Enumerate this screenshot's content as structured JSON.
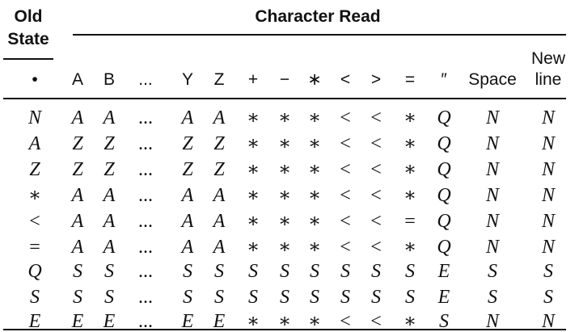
{
  "header": {
    "old_state_line1": "Old",
    "old_state_line2": "State",
    "group_title": "Character Read"
  },
  "columns": [
    "•",
    "A",
    "B",
    "...",
    "Y",
    "Z",
    "+",
    "−",
    "∗",
    "<",
    ">",
    "=",
    "″",
    "Space",
    "New line"
  ],
  "rows": [
    [
      "N",
      "A",
      "A",
      "...",
      "A",
      "A",
      "∗",
      "∗",
      "∗",
      "<",
      "<",
      "∗",
      "Q",
      "N",
      "N"
    ],
    [
      "A",
      "Z",
      "Z",
      "...",
      "Z",
      "Z",
      "∗",
      "∗",
      "∗",
      "<",
      "<",
      "∗",
      "Q",
      "N",
      "N"
    ],
    [
      "Z",
      "Z",
      "Z",
      "...",
      "Z",
      "Z",
      "∗",
      "∗",
      "∗",
      "<",
      "<",
      "∗",
      "Q",
      "N",
      "N"
    ],
    [
      "∗",
      "A",
      "A",
      "...",
      "A",
      "A",
      "∗",
      "∗",
      "∗",
      "<",
      "<",
      "∗",
      "Q",
      "N",
      "N"
    ],
    [
      "<",
      "A",
      "A",
      "...",
      "A",
      "A",
      "∗",
      "∗",
      "∗",
      "<",
      "<",
      "=",
      "Q",
      "N",
      "N"
    ],
    [
      "=",
      "A",
      "A",
      "...",
      "A",
      "A",
      "∗",
      "∗",
      "∗",
      "<",
      "<",
      "∗",
      "Q",
      "N",
      "N"
    ],
    [
      "Q",
      "S",
      "S",
      "...",
      "S",
      "S",
      "S",
      "S",
      "S",
      "S",
      "S",
      "S",
      "E",
      "S",
      "S"
    ],
    [
      "S",
      "S",
      "S",
      "...",
      "S",
      "S",
      "S",
      "S",
      "S",
      "S",
      "S",
      "S",
      "E",
      "S",
      "S"
    ],
    [
      "E",
      "E",
      "E",
      "...",
      "E",
      "E",
      "∗",
      "∗",
      "∗",
      "<",
      "<",
      "∗",
      "S",
      "N",
      "N"
    ]
  ]
}
